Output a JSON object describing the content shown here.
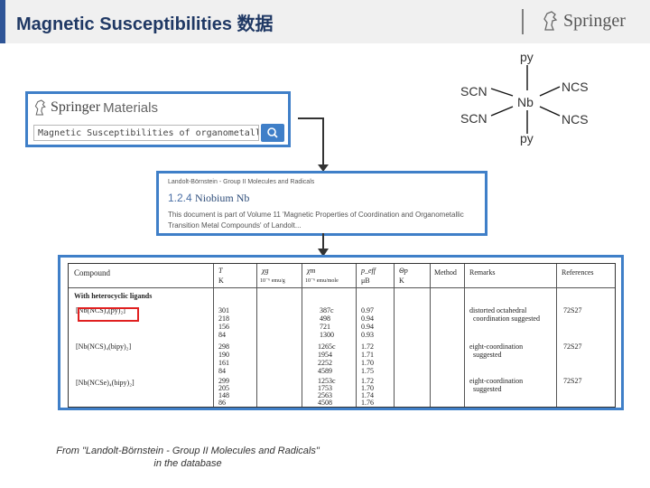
{
  "header": {
    "title": "Magnetic Susceptibilities 数据",
    "logo_text": "Springer"
  },
  "chem": {
    "py_top": "py",
    "scn_left_1": "SCN",
    "scn_left_2": "SCN",
    "center": "Nb",
    "ncs_right_1": "NCS",
    "ncs_right_2": "NCS",
    "py_bottom": "py"
  },
  "search_panel": {
    "logo_brand": "Springer",
    "logo_product": "Materials",
    "search_value": "Magnetic Susceptibilities of organometallic niobium",
    "search_icon": "search-icon"
  },
  "doc_panel": {
    "breadcrumb": "Landolt-Börnstein - Group II Molecules and Radicals",
    "section_number": "1.2.4",
    "section_name": "Niobium Nb",
    "description": "This document is part of Volume 11 'Magnetic Properties of Coordination and Organometallic Transition Metal Compounds' of Landolt..."
  },
  "table": {
    "headers": {
      "compound": "Compound",
      "t": "T",
      "t_unit": "K",
      "xg": "χg",
      "xg_unit": "10⁻⁶ emu/g",
      "xm": "χm",
      "xm_unit": "10⁻⁶ emu/mole",
      "peff": "p_eff",
      "peff_unit": "μB",
      "theta": "Θp",
      "theta_unit": "K",
      "method": "Method",
      "remarks": "Remarks",
      "references": "References"
    },
    "group_title": "With heterocyclic ligands",
    "rows": [
      {
        "compound": "[Nb(NCS)₄(py)₂]",
        "temps": [
          "301",
          "218",
          "156",
          "84"
        ],
        "chi_m": [
          "387c",
          "498",
          "721",
          "1300"
        ],
        "mu": [
          "0.97",
          "0.94",
          "0.94",
          "0.93"
        ],
        "remark1": "distorted octahedral",
        "remark2": "coordination suggested",
        "ref": "72S27"
      },
      {
        "compound": "[Nb(NCS)₄(bipy)₂]",
        "temps": [
          "298",
          "190",
          "161",
          "84"
        ],
        "chi_m": [
          "1265c",
          "1954",
          "2252",
          "4589"
        ],
        "mu": [
          "1.72",
          "1.71",
          "1.70",
          "1.75"
        ],
        "remark1": "eight-coordination",
        "remark2": "suggested",
        "ref": "72S27"
      },
      {
        "compound": "[Nb(NCSe)₄(bipy)₂]",
        "temps": [
          "299",
          "205",
          "148",
          "86"
        ],
        "chi_m": [
          "1253c",
          "1753",
          "2563",
          "4508"
        ],
        "mu": [
          "1.72",
          "1.70",
          "1.74",
          "1.76"
        ],
        "remark1": "eight-coordination",
        "remark2": "suggested",
        "ref": "72S27"
      }
    ]
  },
  "caption": {
    "line1": "From \"Landolt-Börnstein - Group II Molecules and Radicals\"",
    "line2": "in the database"
  },
  "colors": {
    "accent_blue": "#3f7fc8",
    "title_navy": "#1f3864",
    "highlight_red": "#e02020"
  }
}
